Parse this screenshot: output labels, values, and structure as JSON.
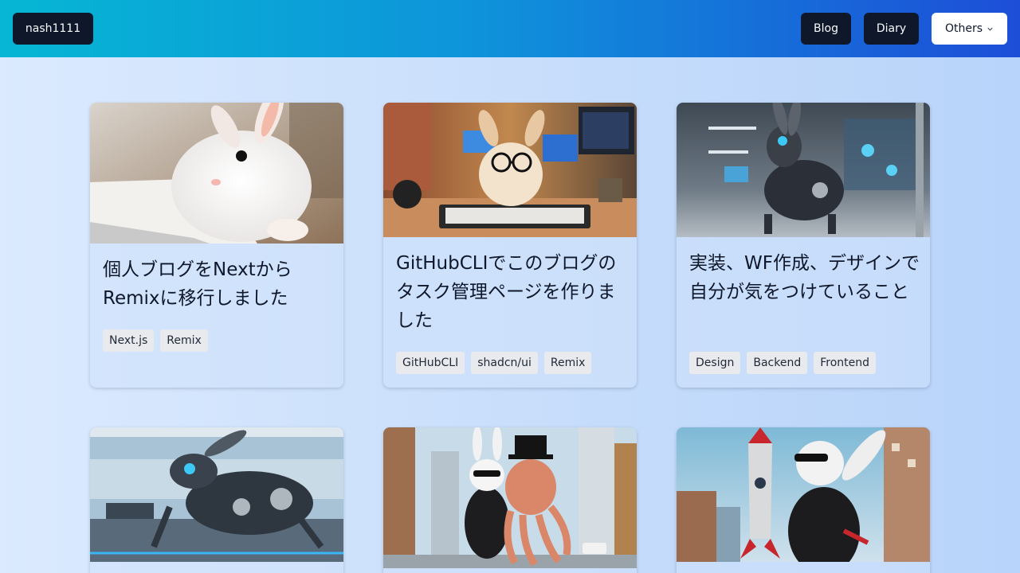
{
  "header": {
    "brand": "nash1111",
    "nav": [
      {
        "label": "Blog"
      },
      {
        "label": "Diary"
      },
      {
        "label": "Others"
      }
    ]
  },
  "posts": [
    {
      "title": "個人ブログをNextからRemixに移行しました",
      "tags": [
        "Next.js",
        "Remix"
      ],
      "image": "white-bunny-at-keyboard"
    },
    {
      "title": "GitHubCLIでこのブログのタスク管理ページを作りました",
      "tags": [
        "GitHubCLI",
        "shadcn/ui",
        "Remix"
      ],
      "image": "bunny-with-glasses-at-desk"
    },
    {
      "title": "実装、WF作成、デザインで自分が気をつけていること",
      "tags": [
        "Design",
        "Backend",
        "Frontend"
      ],
      "image": "robot-rabbit-in-lab"
    },
    {
      "title": "",
      "tags": [],
      "image": "robot-rabbit-running"
    },
    {
      "title": "",
      "tags": [],
      "image": "rabbit-and-octopus-in-city"
    },
    {
      "title": "",
      "tags": [],
      "image": "rabbit-with-rocket"
    }
  ]
}
